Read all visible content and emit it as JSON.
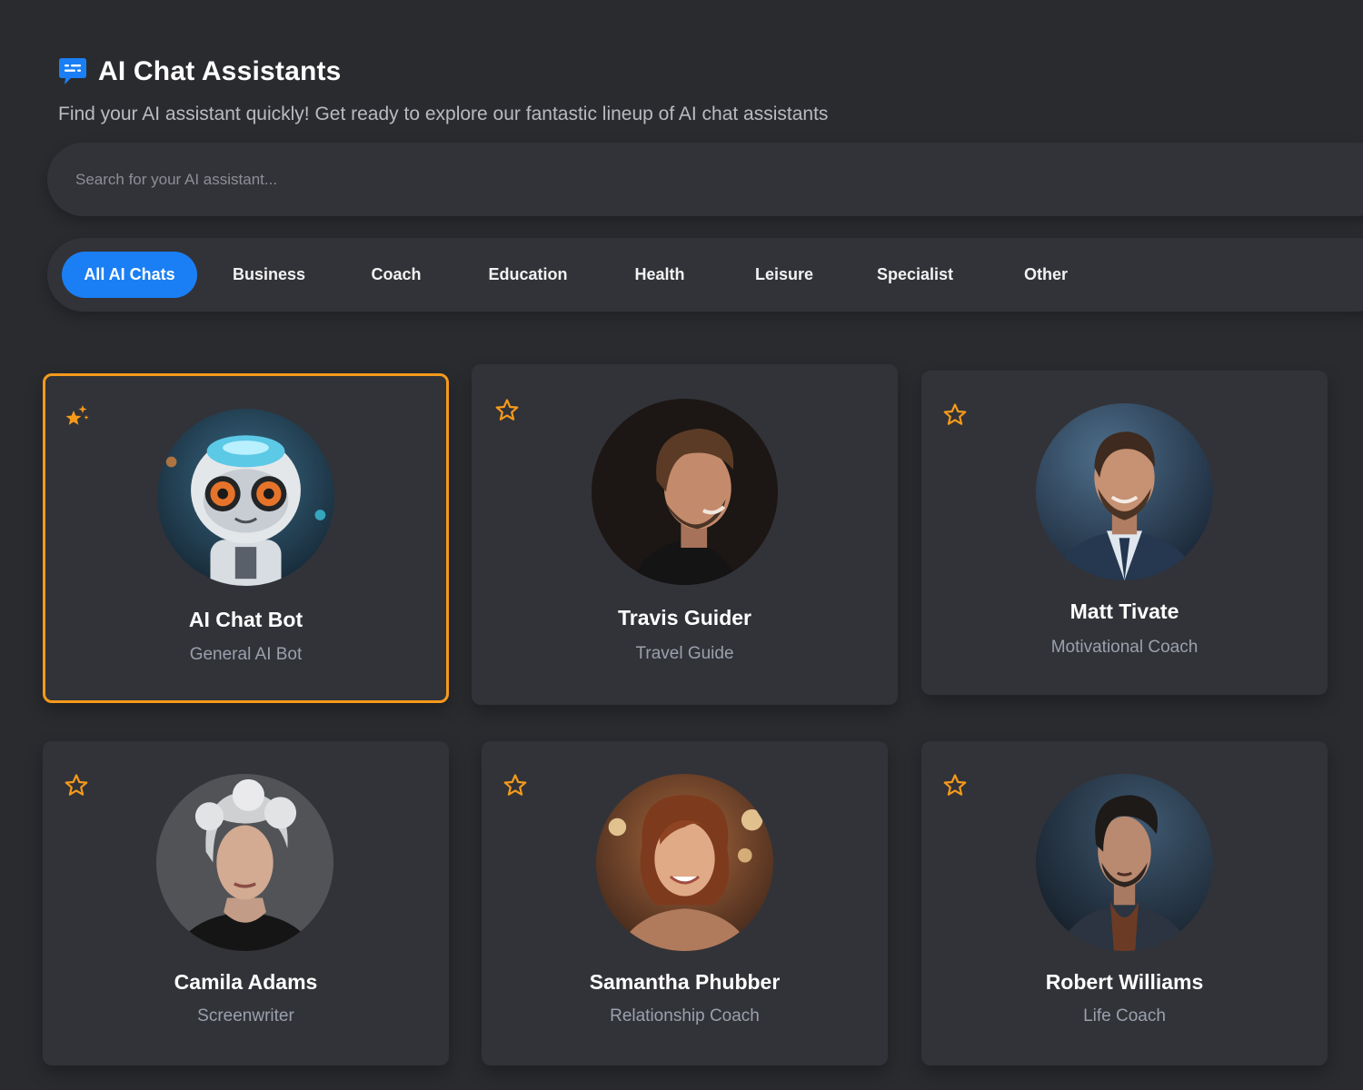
{
  "header": {
    "title": "AI Chat Assistants",
    "subtitle": "Find your AI assistant quickly! Get ready to explore our fantastic lineup of AI chat assistants",
    "icon": "chat-bubble-icon",
    "accent": "#1a7ff5"
  },
  "search": {
    "placeholder": "Search for your AI assistant...",
    "value": ""
  },
  "tabs": [
    {
      "label": "All AI Chats",
      "active": true
    },
    {
      "label": "Business",
      "active": false
    },
    {
      "label": "Coach",
      "active": false
    },
    {
      "label": "Education",
      "active": false
    },
    {
      "label": "Health",
      "active": false
    },
    {
      "label": "Leisure",
      "active": false
    },
    {
      "label": "Specialist",
      "active": false
    },
    {
      "label": "Other",
      "active": false
    }
  ],
  "assistants": [
    {
      "name": "AI Chat Bot",
      "role": "General AI Bot",
      "icon": "sparkle-star-icon",
      "selected": true
    },
    {
      "name": "Travis Guider",
      "role": "Travel Guide",
      "icon": "star-outline-icon",
      "selected": false
    },
    {
      "name": "Matt Tivate",
      "role": "Motivational Coach",
      "icon": "star-outline-icon",
      "selected": false
    },
    {
      "name": "Camila Adams",
      "role": "Screenwriter",
      "icon": "star-outline-icon",
      "selected": false
    },
    {
      "name": "Samantha Phubber",
      "role": "Relationship Coach",
      "icon": "star-outline-icon",
      "selected": false
    },
    {
      "name": "Robert Williams",
      "role": "Life Coach",
      "icon": "star-outline-icon",
      "selected": false
    }
  ],
  "colors": {
    "background": "#2a2b2f",
    "card": "#323338",
    "highlight_border": "#f59a1b",
    "star": "#f59a1b",
    "muted_text": "#9aa0ad"
  }
}
